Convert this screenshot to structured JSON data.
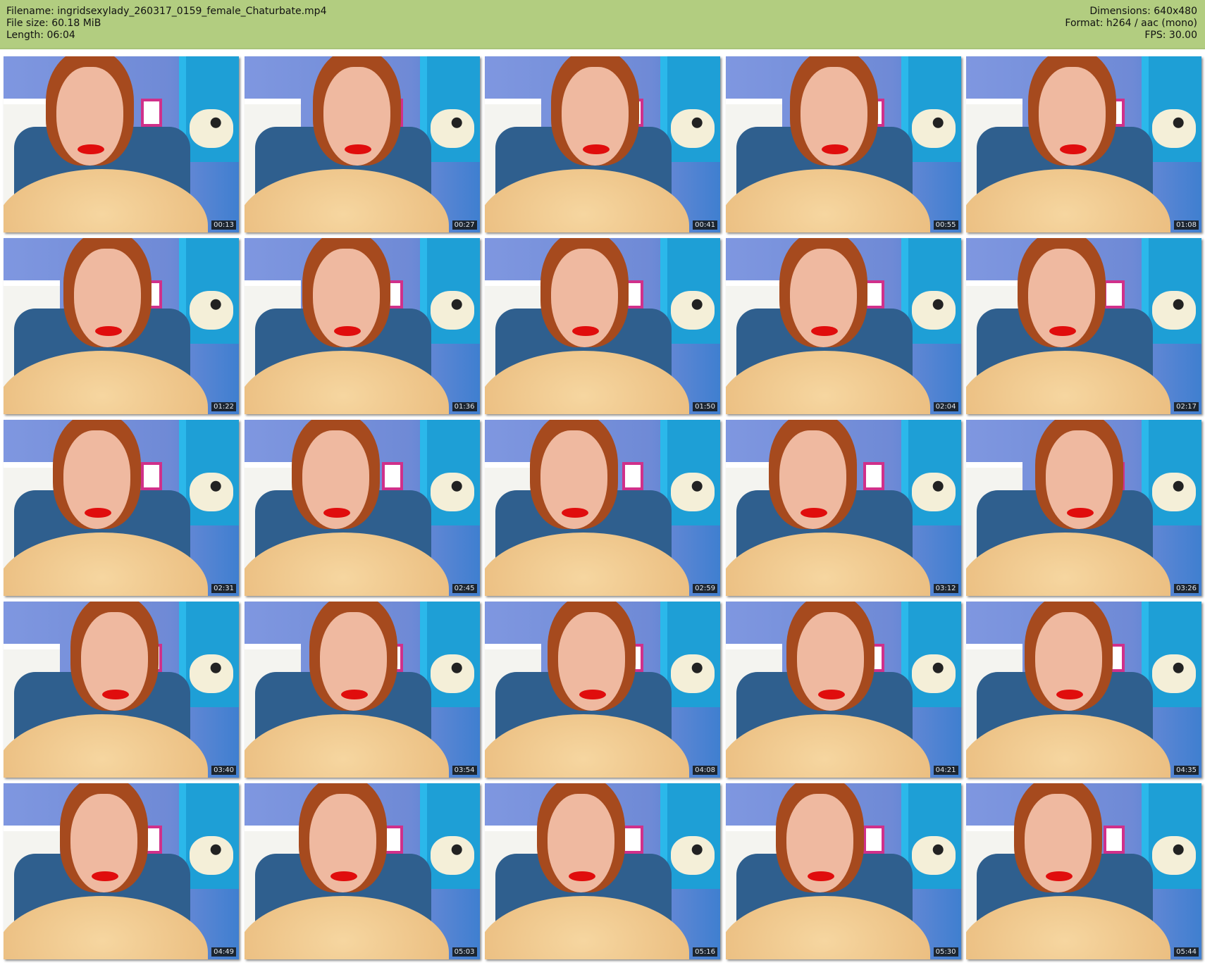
{
  "header": {
    "filename": "Filename: ingridsexylady_260317_0159_female_Chaturbate.mp4",
    "filesize": "File size: 60.18 MiB",
    "length": "Length: 06:04",
    "dimensions": "Dimensions: 640x480",
    "format": "Format: h264 / aac (mono)",
    "fps": "FPS: 30.00"
  },
  "thumbnails": [
    "00:13",
    "00:27",
    "00:41",
    "00:55",
    "01:08",
    "01:22",
    "01:36",
    "01:50",
    "02:04",
    "02:17",
    "02:31",
    "02:45",
    "02:59",
    "03:12",
    "03:26",
    "03:40",
    "03:54",
    "04:08",
    "04:21",
    "04:35",
    "04:49",
    "05:03",
    "05:16",
    "05:30",
    "05:44"
  ]
}
